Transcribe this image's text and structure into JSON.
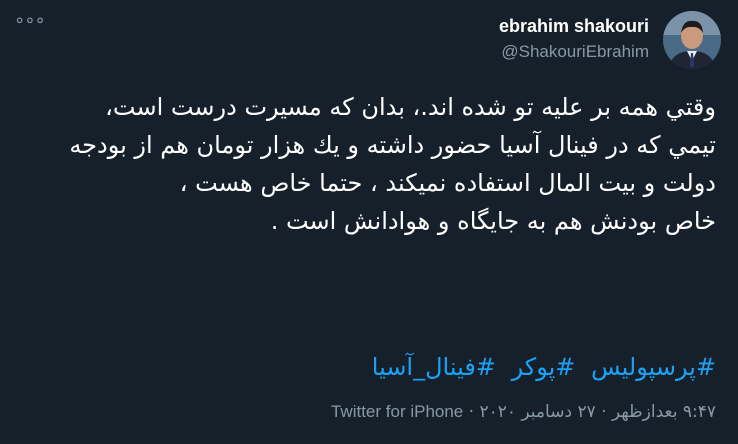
{
  "tweet": {
    "author_name": "ebrahim shakouri",
    "author_handle": "@ShakouriEbrahim",
    "more_icon": "more-dots-icon",
    "avatar_icon": "user-avatar",
    "lines": [
      "وقتي همه بر عليه تو شده اند.، بدان كه مسيرت درست است،",
      "تيمي كه در فينال آسيا حضور داشته و يك هزار تومان هم از بودجه دولت و بيت المال استفاده نميكند ، حتما خاص هست ،",
      "خاص بودنش هم به جايگاه و هوادانش است ."
    ],
    "hashtags": [
      "#پرسپولیس",
      "#پوکر",
      "#فینال_آسیا"
    ],
    "time": "۹:۴۷ بعدازظهر",
    "date": "۲۷ دسامبر ۲۰۲۰",
    "separator": "·",
    "source": "Twitter for iPhone"
  },
  "colors": {
    "background": "#15202b",
    "text": "#ffffff",
    "secondary": "#8899a6",
    "link": "#1da1f2"
  }
}
